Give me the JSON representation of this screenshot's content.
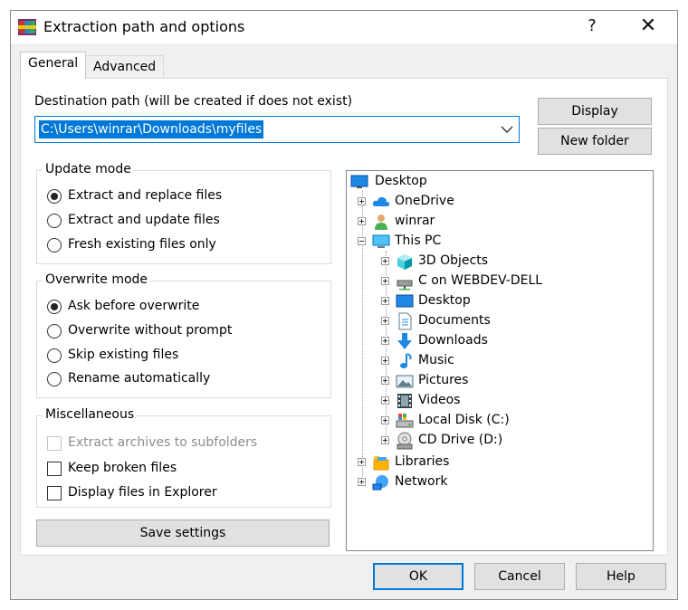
{
  "window": {
    "title": "Extraction path and options",
    "help_glyph": "?",
    "close_glyph": "✕"
  },
  "tabs": [
    {
      "label": "General",
      "active": true
    },
    {
      "label": "Advanced",
      "active": false
    }
  ],
  "destination": {
    "label": "Destination path (will be created if does not exist)",
    "value": "C:\\Users\\winrar\\Downloads\\myfiles"
  },
  "buttons": {
    "display": "Display",
    "new_folder": "New folder",
    "save_settings": "Save settings",
    "ok": "OK",
    "cancel": "Cancel",
    "help": "Help"
  },
  "update_mode": {
    "legend": "Update mode",
    "options": [
      {
        "label": "Extract and replace files",
        "selected": true
      },
      {
        "label": "Extract and update files",
        "selected": false
      },
      {
        "label": "Fresh existing files only",
        "selected": false
      }
    ]
  },
  "overwrite_mode": {
    "legend": "Overwrite mode",
    "options": [
      {
        "label": "Ask before overwrite",
        "selected": true
      },
      {
        "label": "Overwrite without prompt",
        "selected": false
      },
      {
        "label": "Skip existing files",
        "selected": false
      },
      {
        "label": "Rename automatically",
        "selected": false
      }
    ]
  },
  "miscellaneous": {
    "legend": "Miscellaneous",
    "options": [
      {
        "label": "Extract archives to subfolders",
        "checked": false,
        "disabled": true
      },
      {
        "label": "Keep broken files",
        "checked": false,
        "disabled": false
      },
      {
        "label": "Display files in Explorer",
        "checked": false,
        "disabled": false
      }
    ]
  },
  "tree": {
    "root": {
      "label": "Desktop",
      "icon": "desktop-icon"
    },
    "items": [
      {
        "label": "OneDrive",
        "icon": "cloud-icon"
      },
      {
        "label": "winrar",
        "icon": "user-icon"
      },
      {
        "label": "This PC",
        "icon": "computer-icon"
      },
      {
        "label": "3D Objects",
        "icon": "cube-icon"
      },
      {
        "label": "C on WEBDEV-DELL",
        "icon": "network-drive-icon"
      },
      {
        "label": "Desktop",
        "icon": "desktop-icon"
      },
      {
        "label": "Documents",
        "icon": "document-icon"
      },
      {
        "label": "Downloads",
        "icon": "download-icon"
      },
      {
        "label": "Music",
        "icon": "music-icon"
      },
      {
        "label": "Pictures",
        "icon": "picture-icon"
      },
      {
        "label": "Videos",
        "icon": "video-icon"
      },
      {
        "label": "Local Disk (C:)",
        "icon": "disk-icon"
      },
      {
        "label": "CD Drive (D:)",
        "icon": "cd-icon"
      },
      {
        "label": "Libraries",
        "icon": "library-icon"
      },
      {
        "label": "Network",
        "icon": "network-icon"
      }
    ]
  },
  "colors": {
    "accent": "#0078d7",
    "dialog_bg": "#f0f0f0",
    "button_bg": "#e1e1e1"
  }
}
